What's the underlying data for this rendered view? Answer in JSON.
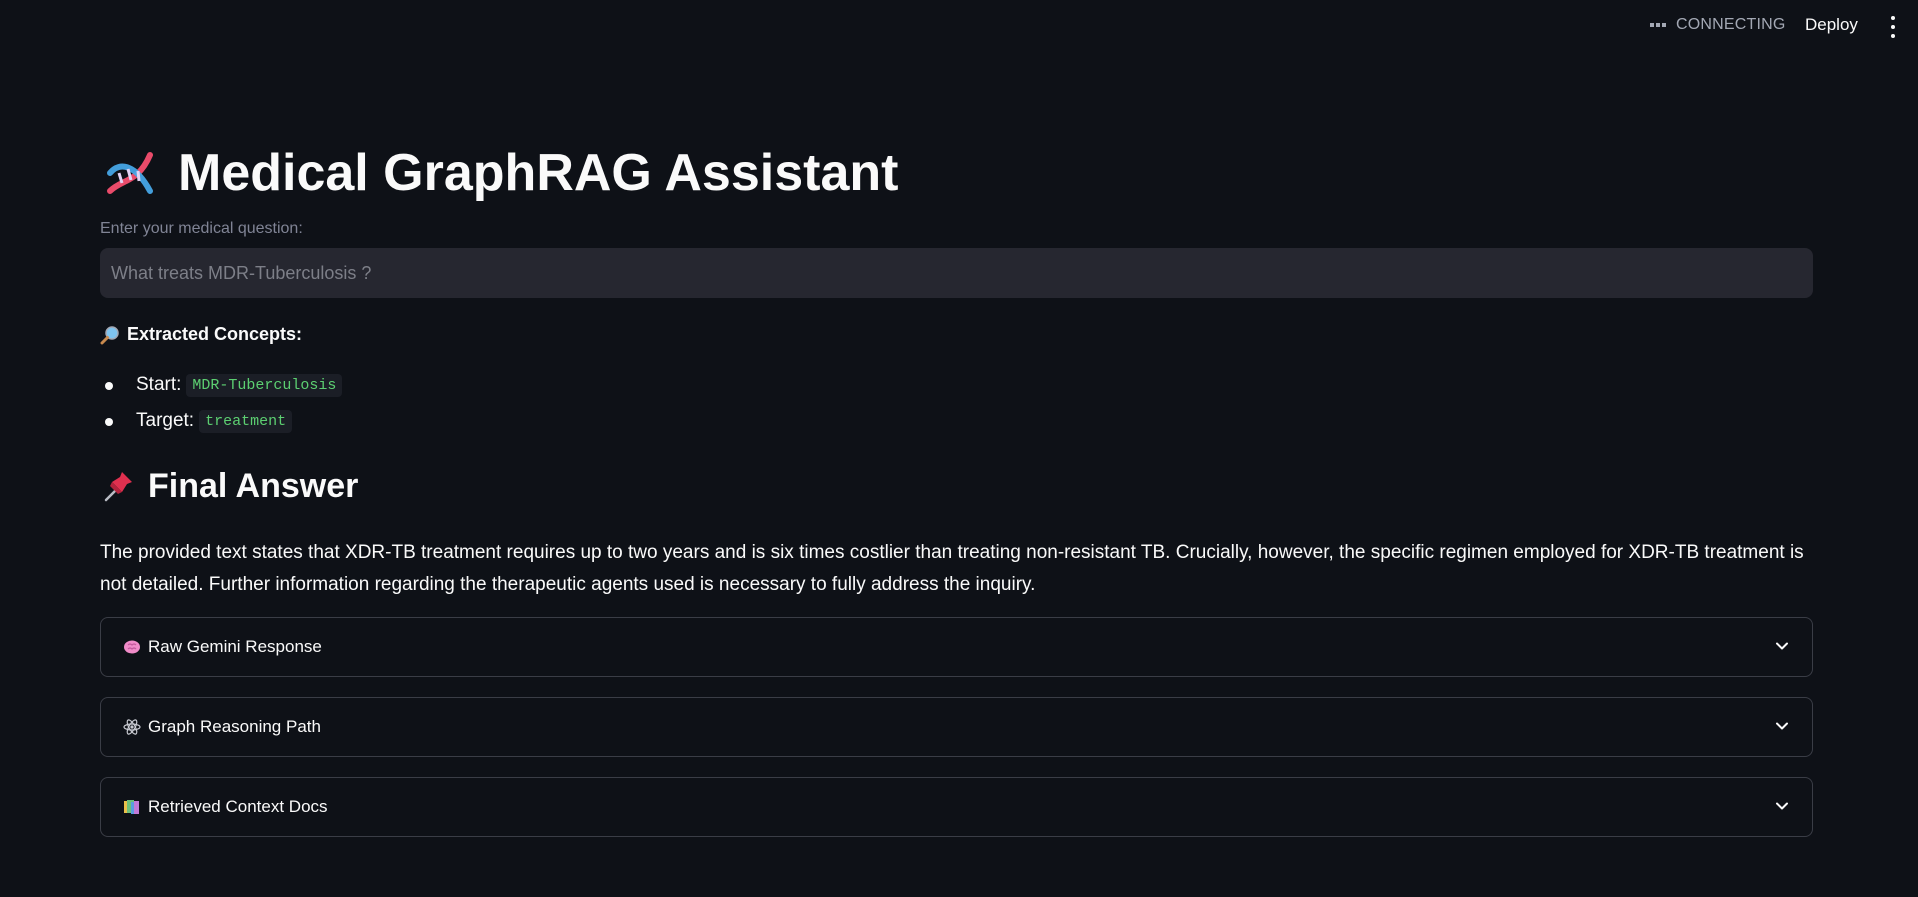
{
  "topbar": {
    "status_text": "CONNECTING",
    "deploy_label": "Deploy",
    "menu_icon": "kebab-menu-icon"
  },
  "header": {
    "title": "Medical GraphRAG Assistant",
    "icon": "dna-icon"
  },
  "question": {
    "label": "Enter your medical question:",
    "placeholder": "What treats MDR-Tuberculosis ?",
    "value": ""
  },
  "concepts": {
    "heading": "Extracted Concepts:",
    "icon": "magnifier-icon",
    "items": [
      {
        "label": "Start:",
        "value": "MDR-Tuberculosis"
      },
      {
        "label": "Target:",
        "value": "treatment"
      }
    ]
  },
  "answer": {
    "heading": "Final Answer",
    "icon": "pushpin-icon",
    "text": "The provided text states that XDR-TB treatment requires up to two years and is six times costlier than treating non-resistant TB. Crucially, however, the specific regimen employed for XDR-TB treatment is not detailed. Further information regarding the therapeutic agents used is necessary to fully address the inquiry."
  },
  "expanders": [
    {
      "label": "Raw Gemini Response",
      "icon": "brain-icon"
    },
    {
      "label": "Graph Reasoning Path",
      "icon": "atom-icon"
    },
    {
      "label": "Retrieved Context Docs",
      "icon": "books-icon"
    }
  ],
  "colors": {
    "background": "#0e1117",
    "input_background": "#262730",
    "code_text": "#5ccf71",
    "border": "#3a3d46"
  }
}
